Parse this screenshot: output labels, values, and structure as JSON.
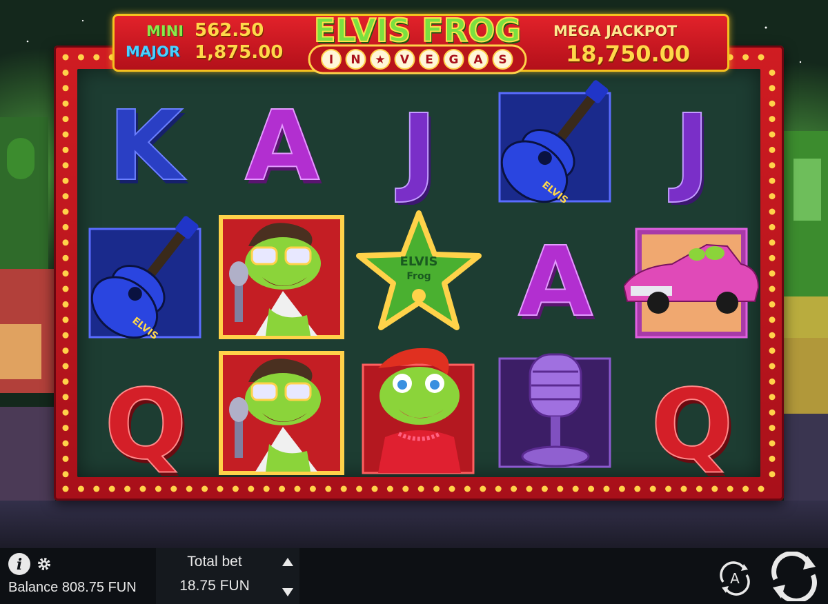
{
  "game": {
    "logo_line1": "ELVIS FROG",
    "logo_line2_letters": [
      "I",
      "N",
      "★",
      "V",
      "E",
      "G",
      "A",
      "S"
    ]
  },
  "jackpots": {
    "mini_label": "MINI",
    "mini_value": "562.50",
    "major_label": "MAJOR",
    "major_value": "1,875.00",
    "mega_label": "MEGA JACKPOT",
    "mega_value": "18,750.00"
  },
  "reels": {
    "row1": [
      "K",
      "A",
      "J",
      "guitar",
      "J"
    ],
    "row2": [
      "guitar",
      "elvis-frog",
      "star-scatter",
      "A",
      "pink-cadillac"
    ],
    "row3": [
      "Q",
      "elvis-frog",
      "lady-frog",
      "microphone",
      "Q"
    ]
  },
  "symbol_texts": {
    "star_line1": "ELVIS",
    "star_line2": "Frog",
    "guitar_text": "ELVIS"
  },
  "colors": {
    "K": "#2a3fc4",
    "A": "#b22fd0",
    "J": "#7a2fc8",
    "Q": "#d41f28",
    "frame_red": "#c8161e",
    "bulb": "#ffd24a",
    "felt": "#1d3d32"
  },
  "bottom_bar": {
    "balance_label": "Balance",
    "balance_value": "808.75 FUN",
    "total_bet_label": "Total bet",
    "total_bet_value": "18.75 FUN",
    "info_icon": "info-icon",
    "settings_icon": "gear-icon",
    "autoplay_label": "A",
    "autoplay_icon": "autoplay-icon",
    "spin_icon": "spin-icon",
    "bet_up_icon": "triangle-up-icon",
    "bet_down_icon": "triangle-down-icon"
  }
}
